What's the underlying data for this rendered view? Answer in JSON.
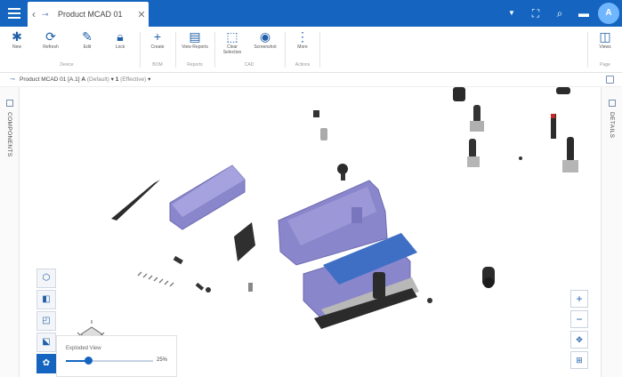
{
  "window": {
    "tab_title": "Product MCAD 01",
    "back_icon": "chevron-left-icon",
    "close_icon": "close-icon"
  },
  "topbar": {
    "icons": [
      "menu-icon",
      "chevron-down-icon",
      "fullscreen-icon",
      "search-icon",
      "chat-icon",
      "user-avatar"
    ],
    "avatar_initial": "A",
    "accent": "#1565c0"
  },
  "ribbon": {
    "groups": [
      {
        "name": "Device",
        "buttons": [
          "New",
          "Refresh",
          "Edit",
          "Lock"
        ]
      },
      {
        "name": "BOM",
        "buttons": [
          "Create"
        ]
      },
      {
        "name": "Reports",
        "buttons": [
          "View Reports"
        ]
      },
      {
        "name": "CAD",
        "buttons": [
          "Clear Selection",
          "Screenshot"
        ]
      },
      {
        "name": "Actions",
        "buttons": [
          "More"
        ]
      },
      {
        "name": "Page",
        "buttons": [
          "Views"
        ]
      }
    ]
  },
  "breadcrumb": {
    "part": "Product MCAD 01 [A.1]",
    "revision": "A",
    "revision_note": "(Default)",
    "iteration": "1",
    "iteration_note": "(Effective)"
  },
  "left_panel": {
    "label": "COMPONENTS"
  },
  "right_panel": {
    "label": "DETAILS"
  },
  "exploded_view": {
    "label": "Exploded View",
    "value_pct": 25,
    "value_text": "25%"
  },
  "colors": {
    "part_purple": "#8a86cc",
    "part_blue": "#3f6fc4",
    "part_dark": "#2b2b2b",
    "part_gray": "#b8b8b8"
  }
}
